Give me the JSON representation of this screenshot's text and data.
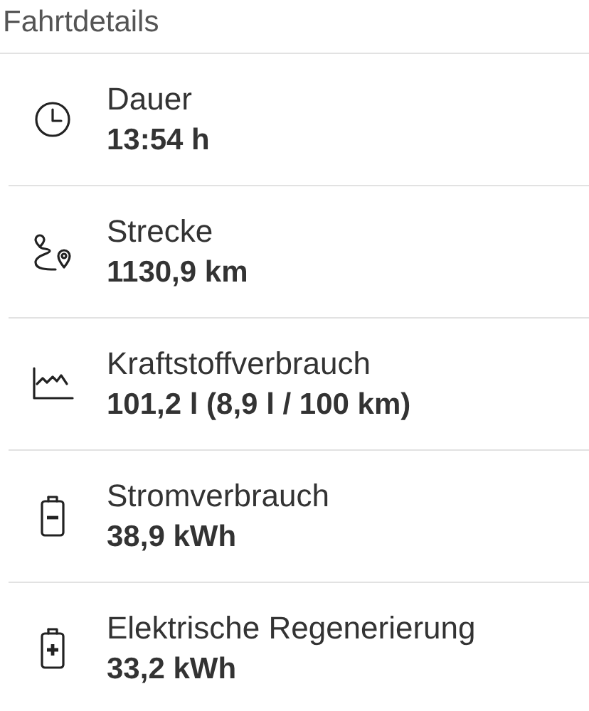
{
  "section_title": "Fahrtdetails",
  "items": [
    {
      "kind": "clock",
      "label": "Dauer",
      "value": "13:54 h"
    },
    {
      "kind": "route",
      "label": "Strecke",
      "value": "1130,9 km"
    },
    {
      "kind": "chart",
      "label": "Kraftstoffverbrauch",
      "value": "101,2 l (8,9 l / 100 km)"
    },
    {
      "kind": "battery-minus",
      "label": "Stromverbrauch",
      "value": "38,9 kWh"
    },
    {
      "kind": "battery-plus",
      "label": "Elektrische Regenerierung",
      "value": "33,2 kWh"
    }
  ]
}
